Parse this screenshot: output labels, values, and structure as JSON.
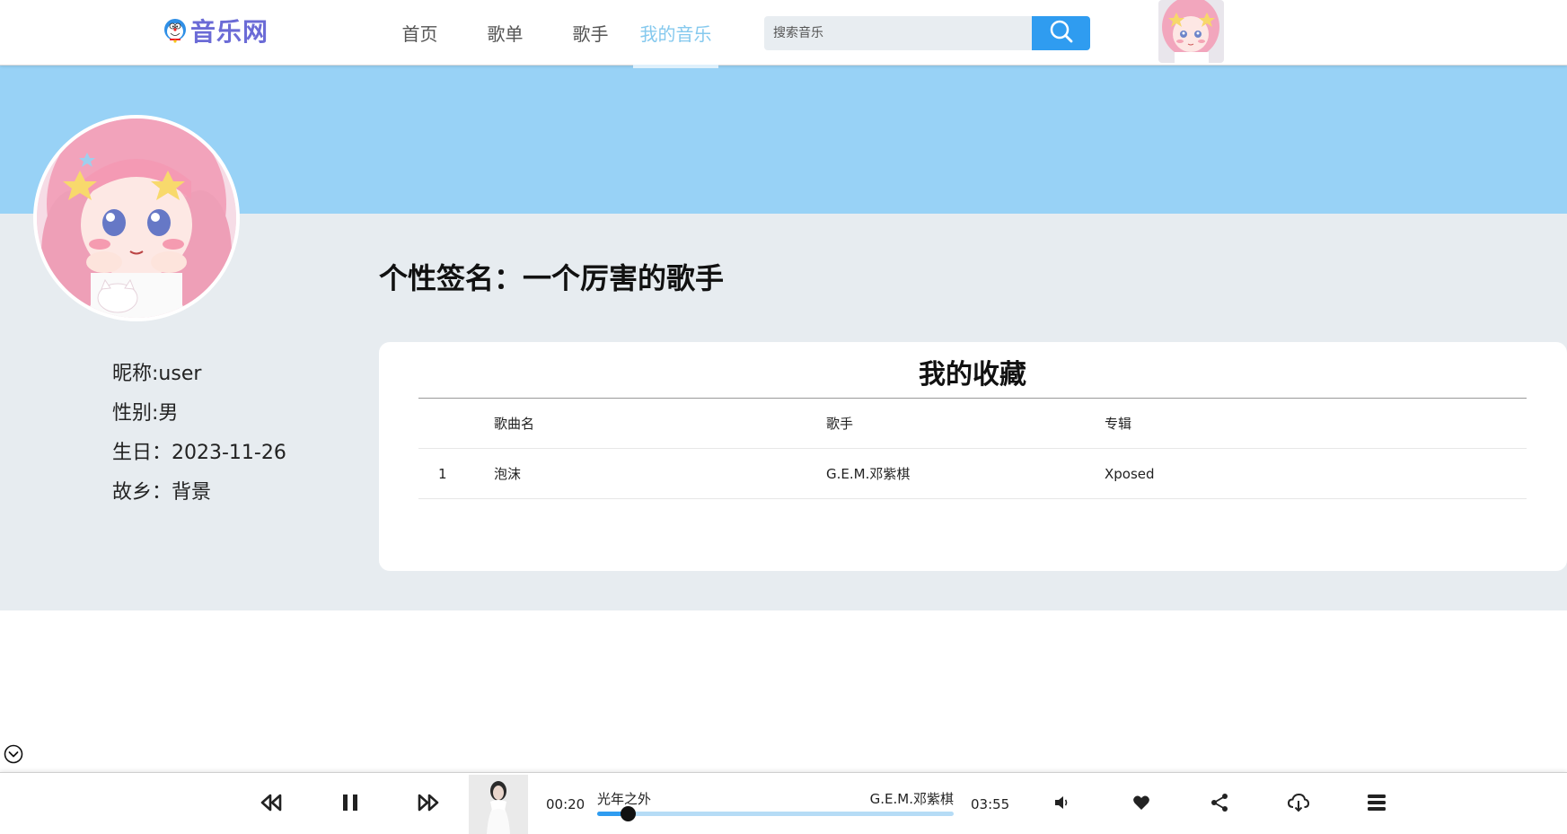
{
  "header": {
    "logo_text": "音乐网",
    "nav": [
      {
        "label": "首页",
        "active": false
      },
      {
        "label": "歌单",
        "active": false
      },
      {
        "label": "歌手",
        "active": false
      },
      {
        "label": "我的音乐",
        "active": true
      }
    ],
    "search_placeholder": "搜索音乐",
    "search_icon": "search-icon"
  },
  "profile": {
    "signature": "个性签名：一个厉害的歌手",
    "nickname": "昵称:user",
    "gender": "性别:男",
    "birthday": "生日：2023-11-26",
    "hometown": "故乡：背景"
  },
  "favorites": {
    "title": "我的收藏",
    "columns": [
      "",
      "歌曲名",
      "歌手",
      "专辑"
    ],
    "rows": [
      {
        "index": "1",
        "song": "泡沫",
        "artist": "G.E.M.邓紫棋",
        "album": "Xposed"
      }
    ]
  },
  "player": {
    "current_time": "00:20",
    "total_time": "03:55",
    "song_title": "光年之外",
    "artist": "G.E.M.邓紫棋",
    "progress": 0.085,
    "controls": [
      "prev-icon",
      "pause-icon",
      "next-icon",
      "volume-icon",
      "heart-icon",
      "share-icon",
      "download-icon",
      "playlist-icon"
    ]
  },
  "colors": {
    "accent": "#2f9cf0",
    "banner": "#98d2f6",
    "nav_active": "#85c9ee",
    "content_bg": "#e7ecf0",
    "logo": "#6b6bd6"
  }
}
